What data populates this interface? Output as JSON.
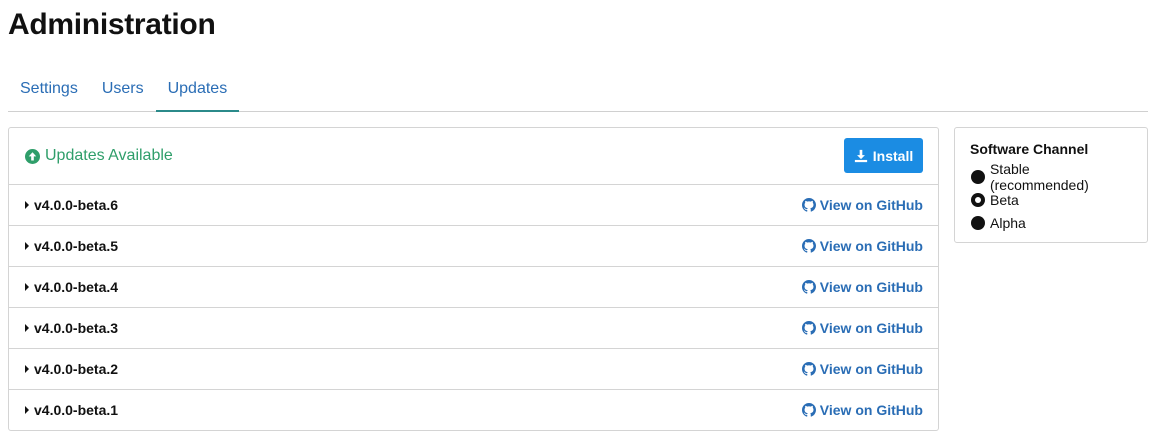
{
  "page": {
    "title": "Administration"
  },
  "tabs": [
    {
      "label": "Settings",
      "active": false
    },
    {
      "label": "Users",
      "active": false
    },
    {
      "label": "Updates",
      "active": true
    }
  ],
  "updates": {
    "status_text": "Updates Available",
    "status_icon": "arrow-circle-up-icon",
    "install_label": "Install",
    "install_icon": "download-icon",
    "colors": {
      "status": "#2f9e6a",
      "install_bg": "#1b8ce3",
      "link": "#2a6db5"
    },
    "releases": [
      {
        "version": "v4.0.0-beta.6",
        "link_label": "View on GitHub"
      },
      {
        "version": "v4.0.0-beta.5",
        "link_label": "View on GitHub"
      },
      {
        "version": "v4.0.0-beta.4",
        "link_label": "View on GitHub"
      },
      {
        "version": "v4.0.0-beta.3",
        "link_label": "View on GitHub"
      },
      {
        "version": "v4.0.0-beta.2",
        "link_label": "View on GitHub"
      },
      {
        "version": "v4.0.0-beta.1",
        "link_label": "View on GitHub"
      }
    ]
  },
  "channel": {
    "title": "Software Channel",
    "selected": "Beta",
    "options": [
      {
        "label": "Stable (recommended)"
      },
      {
        "label": "Beta"
      },
      {
        "label": "Alpha"
      }
    ]
  }
}
